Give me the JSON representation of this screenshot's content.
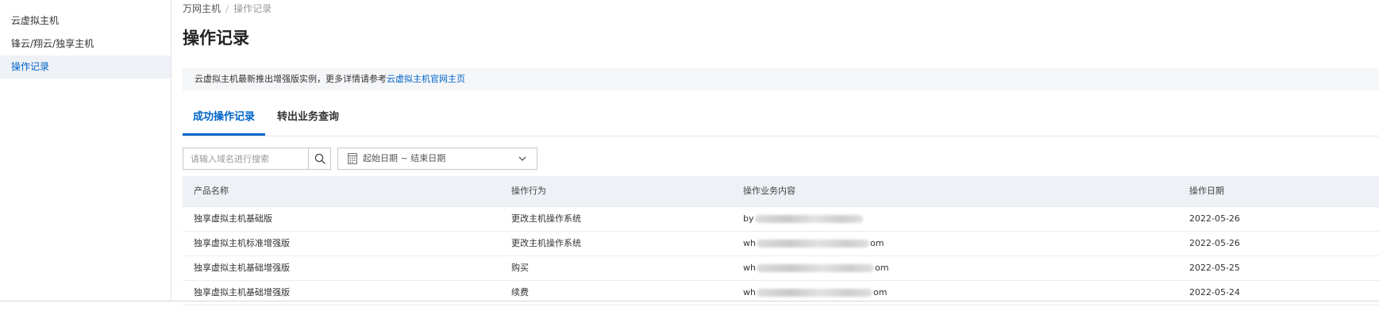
{
  "sidebar": {
    "items": [
      {
        "label": "云虚拟主机",
        "active": false
      },
      {
        "label": "锋云/翔云/独享主机",
        "active": false
      },
      {
        "label": "操作记录",
        "active": true
      }
    ]
  },
  "breadcrumb": {
    "root": "万网主机",
    "separator": "/",
    "current": "操作记录"
  },
  "page_title": "操作记录",
  "notice": {
    "text": "云虚拟主机最新推出增强版实例，更多详情请参考",
    "link_text": "云虚拟主机官网主页"
  },
  "tabs": [
    {
      "label": "成功操作记录",
      "active": true
    },
    {
      "label": "转出业务查询",
      "active": false
    }
  ],
  "search": {
    "placeholder": "请输入域名进行搜索",
    "value": "",
    "icon": "search-icon"
  },
  "date_range": {
    "start_placeholder": "起始日期",
    "separator": "~",
    "end_placeholder": "结束日期",
    "display": "起始日期 ~ 结束日期",
    "icon": "calendar-icon"
  },
  "table": {
    "columns": [
      "产品名称",
      "操作行为",
      "操作业务内容",
      "操作日期"
    ],
    "rows": [
      {
        "product": "独享虚拟主机基础版",
        "action": "更改主机操作系统",
        "content_prefix": "by",
        "content_suffix": "",
        "date": "2022-05-26"
      },
      {
        "product": "独享虚拟主机标准增强版",
        "action": "更改主机操作系统",
        "content_prefix": "wh",
        "content_suffix": "om",
        "date": "2022-05-26"
      },
      {
        "product": "独享虚拟主机基础增强版",
        "action": "购买",
        "content_prefix": "wh",
        "content_suffix": "om",
        "date": "2022-05-25"
      },
      {
        "product": "独享虚拟主机基础增强版",
        "action": "续费",
        "content_prefix": "wh",
        "content_suffix": "om",
        "date": "2022-05-24"
      }
    ]
  },
  "colors": {
    "accent": "#0064c8",
    "active_bg": "#eef1f6",
    "header_bg": "#eef1f6",
    "notice_bg": "#f5f6f8"
  }
}
